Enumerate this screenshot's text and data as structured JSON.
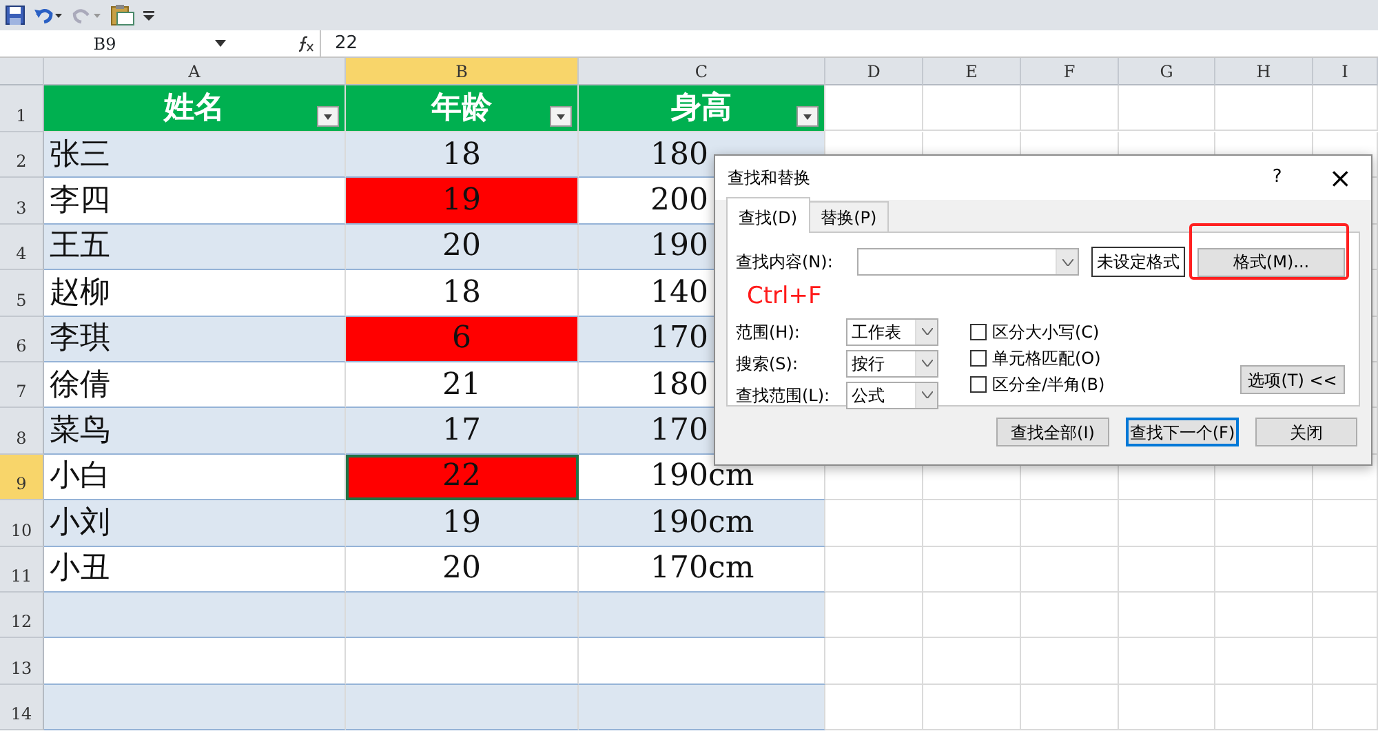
{
  "formula_bar": {
    "name_box": "B9",
    "value": "22"
  },
  "columns": [
    {
      "label": "A",
      "selected": false
    },
    {
      "label": "B",
      "selected": true
    },
    {
      "label": "C",
      "selected": false
    },
    {
      "label": "D",
      "selected": false
    },
    {
      "label": "E",
      "selected": false
    },
    {
      "label": "F",
      "selected": false
    },
    {
      "label": "G",
      "selected": false
    },
    {
      "label": "H",
      "selected": false
    },
    {
      "label": "I",
      "selected": false
    }
  ],
  "rows": [
    {
      "number": "1",
      "selected": false,
      "kind": "header",
      "cells": [
        {
          "text": "姓名",
          "highlighted": false,
          "selected": false
        },
        {
          "text": "年龄",
          "highlighted": false,
          "selected": false
        },
        {
          "text": "身高",
          "highlighted": false,
          "selected": false
        }
      ]
    },
    {
      "number": "2",
      "selected": false,
      "kind": "data",
      "cells": [
        {
          "text": "张三",
          "highlighted": false,
          "selected": false
        },
        {
          "text": "18",
          "highlighted": false,
          "selected": false
        },
        {
          "text": "180",
          "highlighted": false,
          "selected": false
        }
      ]
    },
    {
      "number": "3",
      "selected": false,
      "kind": "data",
      "cells": [
        {
          "text": "李四",
          "highlighted": false,
          "selected": false
        },
        {
          "text": "19",
          "highlighted": true,
          "selected": false
        },
        {
          "text": "200",
          "highlighted": false,
          "selected": false
        }
      ]
    },
    {
      "number": "4",
      "selected": false,
      "kind": "data",
      "cells": [
        {
          "text": "王五",
          "highlighted": false,
          "selected": false
        },
        {
          "text": "20",
          "highlighted": false,
          "selected": false
        },
        {
          "text": "190",
          "highlighted": false,
          "selected": false
        }
      ]
    },
    {
      "number": "5",
      "selected": false,
      "kind": "data",
      "cells": [
        {
          "text": "赵柳",
          "highlighted": false,
          "selected": false
        },
        {
          "text": "18",
          "highlighted": false,
          "selected": false
        },
        {
          "text": "140",
          "highlighted": false,
          "selected": false
        }
      ]
    },
    {
      "number": "6",
      "selected": false,
      "kind": "data",
      "cells": [
        {
          "text": "李琪",
          "highlighted": false,
          "selected": false
        },
        {
          "text": "6",
          "highlighted": true,
          "selected": false
        },
        {
          "text": "170",
          "highlighted": false,
          "selected": false
        }
      ]
    },
    {
      "number": "7",
      "selected": false,
      "kind": "data",
      "cells": [
        {
          "text": "徐倩",
          "highlighted": false,
          "selected": false
        },
        {
          "text": "21",
          "highlighted": false,
          "selected": false
        },
        {
          "text": "180",
          "highlighted": false,
          "selected": false
        }
      ]
    },
    {
      "number": "8",
      "selected": false,
      "kind": "data",
      "cells": [
        {
          "text": "菜鸟",
          "highlighted": false,
          "selected": false
        },
        {
          "text": "17",
          "highlighted": false,
          "selected": false
        },
        {
          "text": "170",
          "highlighted": false,
          "selected": false
        }
      ]
    },
    {
      "number": "9",
      "selected": true,
      "kind": "data",
      "cells": [
        {
          "text": "小白",
          "highlighted": false,
          "selected": false
        },
        {
          "text": "22",
          "highlighted": true,
          "selected": true
        },
        {
          "text": "190cm",
          "highlighted": false,
          "selected": false
        }
      ]
    },
    {
      "number": "10",
      "selected": false,
      "kind": "data",
      "cells": [
        {
          "text": "小刘",
          "highlighted": false,
          "selected": false
        },
        {
          "text": "19",
          "highlighted": false,
          "selected": false
        },
        {
          "text": "190cm",
          "highlighted": false,
          "selected": false
        }
      ]
    },
    {
      "number": "11",
      "selected": false,
      "kind": "data",
      "cells": [
        {
          "text": "小丑",
          "highlighted": false,
          "selected": false
        },
        {
          "text": "20",
          "highlighted": false,
          "selected": false
        },
        {
          "text": "170cm",
          "highlighted": false,
          "selected": false
        }
      ]
    },
    {
      "number": "12",
      "selected": false,
      "kind": "empty",
      "cells": []
    },
    {
      "number": "13",
      "selected": false,
      "kind": "empty",
      "cells": []
    },
    {
      "number": "14",
      "selected": false,
      "kind": "empty",
      "cells": []
    }
  ],
  "dialog": {
    "title": "查找和替换",
    "help": "?",
    "close": "×",
    "tabs": [
      {
        "label": "查找(D)",
        "selected": true
      },
      {
        "label": "替换(P)",
        "selected": false
      }
    ],
    "find_label": "查找内容(N):",
    "format_status": "未设定格式",
    "format_button": "格式(M)...",
    "annotation": "Ctrl+F",
    "selects": [
      {
        "label": "范围(H):",
        "value": "工作表"
      },
      {
        "label": "搜索(S):",
        "value": "按行"
      },
      {
        "label": "查找范围(L):",
        "value": "公式"
      }
    ],
    "checkboxes": [
      {
        "label": "区分大小写(C)",
        "checked": false
      },
      {
        "label": "单元格匹配(O)",
        "checked": false
      },
      {
        "label": "区分全/半角(B)",
        "checked": false
      }
    ],
    "options_button": "选项(T) <<",
    "buttons": [
      {
        "label": "查找全部(I)",
        "default": false
      },
      {
        "label": "查找下一个(F)",
        "default": true
      },
      {
        "label": "关闭",
        "default": false
      }
    ]
  }
}
